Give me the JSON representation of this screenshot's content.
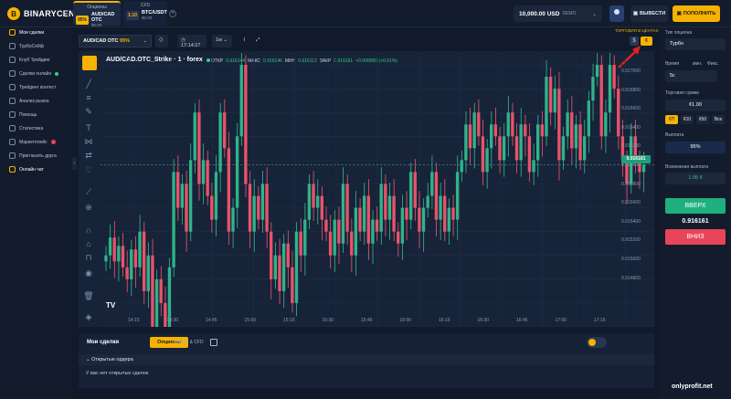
{
  "brand": {
    "name": "BINARYCENT"
  },
  "assets": [
    {
      "category": "Опционы",
      "percent": "95%",
      "name": "AUD/CAD OTC",
      "sub": "$0,00"
    },
    {
      "category": "CFD",
      "percent": "1:10",
      "name": "BTC/USDT",
      "sub": "$0,00"
    }
  ],
  "header": {
    "balance": "10,000.00 USD",
    "mode": "DEMO",
    "withdraw": "ВЫВЕСТИ",
    "deposit": "ПОПОЛНИТЬ"
  },
  "sidebar": {
    "items": [
      {
        "label": "Мои сделки",
        "active": true
      },
      {
        "label": "ТурбоСейф"
      },
      {
        "label": "Клуб Трейдинг"
      },
      {
        "label": "Сделки онлайн",
        "badge": "green"
      },
      {
        "label": "Трейдинг контест"
      },
      {
        "label": "Анализ рынка"
      },
      {
        "label": "Помощь"
      },
      {
        "label": "Статистика"
      },
      {
        "label": "Маркетплейс",
        "badge": "red"
      },
      {
        "label": "Пригласить друга"
      },
      {
        "label": "Онлайн чат",
        "active": true
      }
    ]
  },
  "toolbar": {
    "pair": "AUD/CAD OTC",
    "pair_pct": "95%",
    "time": "17:14:27",
    "timeframe": "1м"
  },
  "chart_header": {
    "title": "AUD/CAD.OTC_Strike · 1 · forex",
    "open_label": "ОТКР",
    "open": "0.916144",
    "high_label": "МАКС",
    "high": "0.916146",
    "low_label": "МИН",
    "low": "0.916113",
    "close_label": "ЗАКР",
    "close": "0.916161",
    "change": "+0.000065 (+0.01%)"
  },
  "center_trade": {
    "label": "ТОРГОВЛЯ В ЦЕНТАХ",
    "dollar": "$",
    "cent": "¢"
  },
  "chart_data": {
    "type": "candlestick",
    "price_ticks": [
      "0.917000",
      "0.916800",
      "0.916600",
      "0.916400",
      "0.916200",
      "0.916000",
      "0.915800",
      "0.915600",
      "0.915400",
      "0.915200",
      "0.915000",
      "0.914800"
    ],
    "time_ticks": [
      "14:15",
      "14:30",
      "14:45",
      "15:00",
      "15:15",
      "15:30",
      "15:45",
      "16:00",
      "16:15",
      "16:30",
      "16:45",
      "17:00",
      "17:15"
    ],
    "ylim": [
      0.9148,
      0.9171
    ],
    "current_price": "0.916161",
    "colors": {
      "up": "#2fb38a",
      "down": "#e8536a"
    },
    "closes": [
      0.9154,
      0.91555,
      0.91535,
      0.91548,
      0.9153,
      0.9152,
      0.91545,
      0.9153,
      0.9156,
      0.9151,
      0.9154,
      0.9145,
      0.9152,
      0.915,
      0.9147,
      0.9153,
      0.9161,
      0.9158,
      0.916,
      0.9156,
      0.9162,
      0.9166,
      0.916,
      0.9162,
      0.9159,
      0.9157,
      0.9161,
      0.9166,
      0.9163,
      0.9156,
      0.9158,
      0.9164,
      0.917,
      0.916,
      0.9156,
      0.9159,
      0.9157,
      0.916,
      0.9156,
      0.9152,
      0.9154,
      0.9151,
      0.9155,
      0.9153,
      0.915,
      0.9156,
      0.9154,
      0.9157,
      0.916,
      0.9158,
      0.9159,
      0.9157,
      0.9156,
      0.9154,
      0.9157,
      0.9155,
      0.916,
      0.9156,
      0.9154,
      0.9158,
      0.9156,
      0.9159,
      0.9155,
      0.9157,
      0.9156,
      0.916,
      0.9157,
      0.9159,
      0.9156,
      0.9155,
      0.9158,
      0.9157,
      0.9161,
      0.9158,
      0.9156,
      0.9158,
      0.9159,
      0.9161,
      0.9157,
      0.9159,
      0.9156,
      0.9158,
      0.9157,
      0.9161,
      0.9162,
      0.9165,
      0.9163,
      0.9166,
      0.9164,
      0.9161,
      0.9163,
      0.9165,
      0.9164,
      0.9162,
      0.9164,
      0.9166,
      0.9164,
      0.9162,
      0.9165,
      0.9164,
      0.9161,
      0.9162,
      0.9165,
      0.9164,
      0.9169,
      0.9166,
      0.9168,
      0.9162,
      0.9164,
      0.9166,
      0.9163,
      0.9165,
      0.9162,
      0.9164,
      0.9167,
      0.9169,
      0.917,
      0.9164,
      0.9166,
      0.917,
      0.9168,
      0.9164,
      0.9162,
      0.916,
      0.9164,
      0.9162,
      0.9161,
      0.91616
    ]
  },
  "bottom": {
    "title": "Мои сделки",
    "tab_options": "Опционы",
    "tab_forex": "Форекс & CFD",
    "open_orders": "Открытые ордера",
    "empty": "У вас нет открытых сделок"
  },
  "right_panel": {
    "option_type_label": "Тип опциона",
    "option_type": "Турбо",
    "time_label": "Время",
    "min_label": "мин.",
    "fixed_label": "Фикс.",
    "time_value": "5с",
    "amount_label": "Торговая сумма",
    "amount": "¢1.00",
    "chips": [
      "¢П",
      "¢10",
      "¢50",
      "Все"
    ],
    "payout_label": "Выплата",
    "payout": "95%",
    "possible_label": "Возможная выплата",
    "possible": "1.95 ¢",
    "up": "ВВЕРХ",
    "price": "0.916161",
    "down": "ВНИЗ"
  },
  "watermark": "onlyprofit.net"
}
